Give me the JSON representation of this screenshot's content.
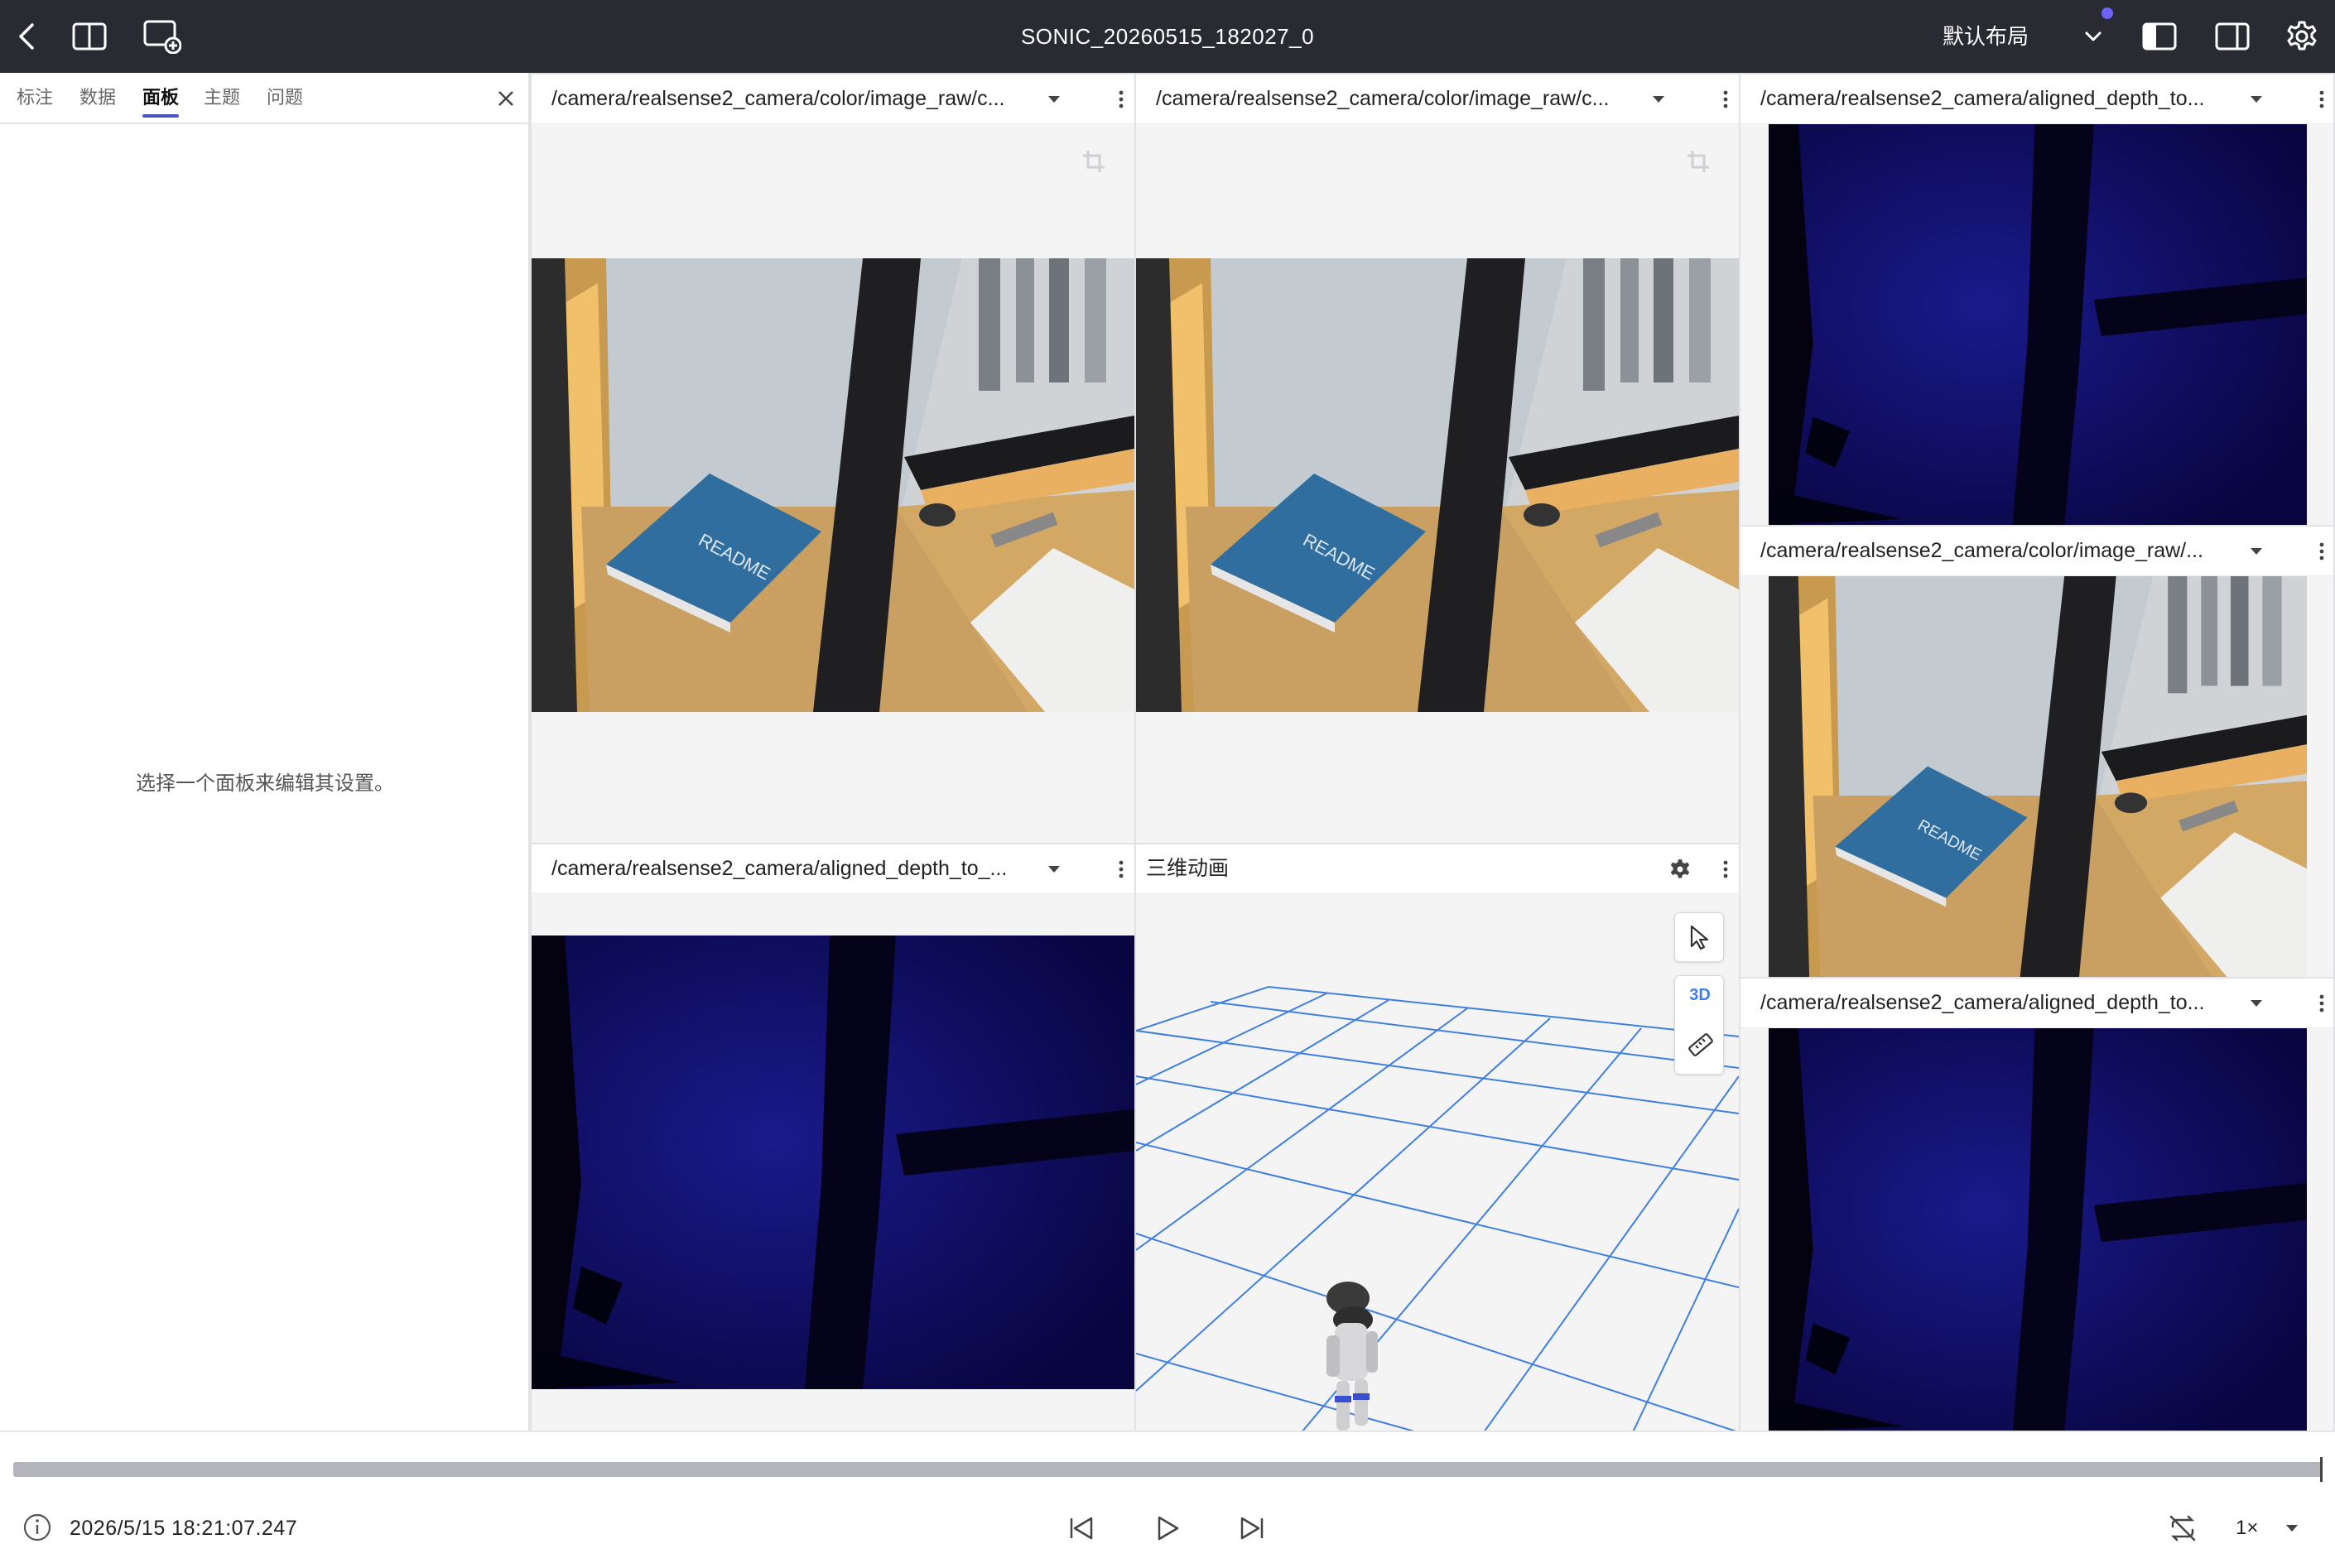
{
  "app": {
    "title": "SONIC_20260515_182027_0",
    "layout_label": "默认布局",
    "accent": "#4a52c8",
    "topbar_bg": "#2a2a33"
  },
  "sidebar": {
    "tabs": [
      {
        "label": "标注"
      },
      {
        "label": "数据"
      },
      {
        "label": "面板",
        "active": true
      },
      {
        "label": "主题"
      },
      {
        "label": "问题"
      }
    ],
    "empty_message": "选择一个面板来编辑其设置。"
  },
  "panels": {
    "image_a": {
      "title": "/camera/realsense2_camera/color/image_raw/c..."
    },
    "image_b": {
      "title": "/camera/realsense2_camera/color/image_raw/c..."
    },
    "image_c": {
      "title": "/camera/realsense2_camera/aligned_depth_to_..."
    },
    "three_d": {
      "title": "三维动画",
      "view_mode": "3D"
    },
    "right_top": {
      "title": "/camera/realsense2_camera/aligned_depth_to..."
    },
    "right_mid": {
      "title": "/camera/realsense2_camera/color/image_raw/..."
    },
    "right_bot": {
      "title": "/camera/realsense2_camera/aligned_depth_to..."
    }
  },
  "playback": {
    "timestamp": "2026/5/15 18:21:07.247",
    "speed": "1×",
    "progress": 1.0
  }
}
